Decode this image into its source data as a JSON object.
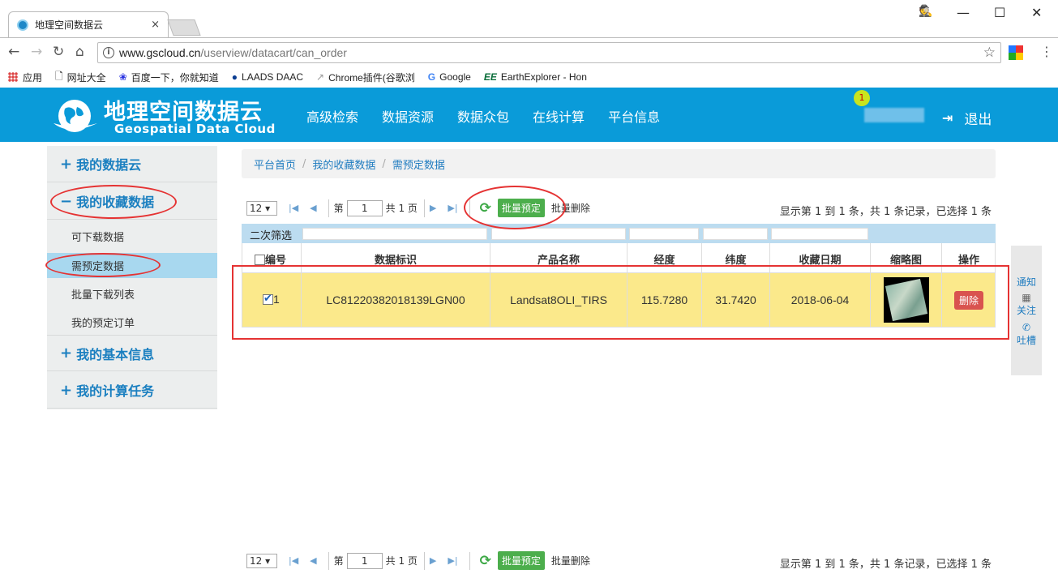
{
  "browser": {
    "tab_title": "地理空间数据云",
    "tab_close": "×",
    "window_controls": {
      "user": "🕵",
      "minimize": "—",
      "maximize": "☐",
      "close": "✕"
    },
    "url_domain": "www.gscloud.cn",
    "url_path": "/userview/datacart/can_order",
    "bookmarks": [
      {
        "label": "应用",
        "icon": "apps-grid-icon"
      },
      {
        "label": "网址大全",
        "icon": "page-icon"
      },
      {
        "label": "百度一下，你就知道",
        "icon": "baidu-paw-icon"
      },
      {
        "label": "LAADS DAAC",
        "icon": "nasa-icon"
      },
      {
        "label": "Chrome插件(谷歌浏",
        "icon": "chrome-plugin-icon"
      },
      {
        "label": "Google",
        "icon": "google-icon"
      },
      {
        "label": "EarthExplorer - Hon",
        "icon": "ee-icon"
      }
    ]
  },
  "site": {
    "logo_cn": "地理空间数据云",
    "logo_en": "Geospatial Data Cloud",
    "nav": [
      "高级检索",
      "数据资源",
      "数据众包",
      "在线计算",
      "平台信息"
    ],
    "notification_count": "1",
    "logout_label": "退出"
  },
  "sidebar": {
    "sections": [
      {
        "sign": "+",
        "label": "我的数据云"
      },
      {
        "sign": "−",
        "label": "我的收藏数据"
      },
      {
        "sign": "+",
        "label": "我的基本信息"
      },
      {
        "sign": "+",
        "label": "我的计算任务"
      }
    ],
    "sub_items": [
      "可下载数据",
      "需预定数据",
      "批量下载列表",
      "我的预定订单"
    ],
    "active_sub": "需预定数据"
  },
  "breadcrumb": [
    "平台首页",
    "我的收藏数据",
    "需预定数据"
  ],
  "breadcrumb_sep": "/",
  "pager": {
    "page_size": "12 ▾",
    "page_prefix": "第",
    "current_page": "1",
    "page_suffix": "共 1 页",
    "batch_order_label": "批量预定",
    "batch_delete_label": "批量删除",
    "info": "显示第 1 到 1 条，共 1 条记录，已选择 1 条"
  },
  "table": {
    "filter_label": "二次筛选",
    "headers": [
      "编号",
      "数据标识",
      "产品名称",
      "经度",
      "纬度",
      "收藏日期",
      "缩略图",
      "操作"
    ],
    "rows": [
      {
        "id": "1",
        "data_id": "LC81220382018139LGN00",
        "product": "Landsat8OLI_TIRS",
        "lon": "115.7280",
        "lat": "31.7420",
        "date": "2018-06-04",
        "action": "删除",
        "checked": true
      }
    ]
  },
  "side_panel": [
    "通知",
    "关注",
    "吐槽"
  ],
  "colors": {
    "header_blue": "#0a9bd9",
    "row_highlight": "#fbe98b",
    "annotation_red": "#e53333",
    "batch_green": "#4cae4c",
    "delete_red": "#d9534f"
  }
}
